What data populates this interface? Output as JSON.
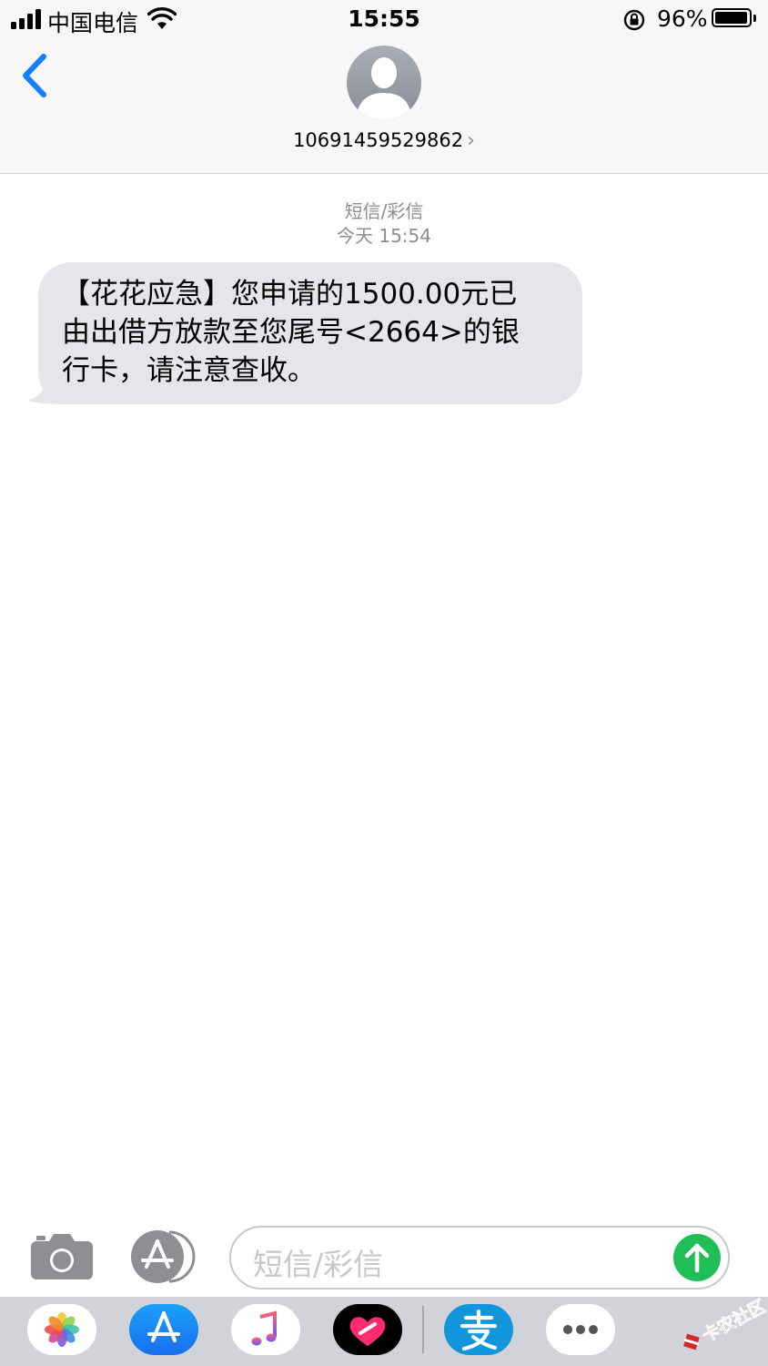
{
  "status_bar": {
    "carrier": "中国电信",
    "time": "15:55",
    "battery_percent": "96%",
    "battery_level": 0.96,
    "signal_bars": 4
  },
  "header": {
    "contact_number": "10691459529862",
    "back_icon": "chevron-left-icon",
    "avatar_icon": "person-silhouette-icon"
  },
  "conversation": {
    "service_label": "短信/彩信",
    "timestamp": "今天 15:54",
    "messages": [
      {
        "direction": "incoming",
        "lines": [
          "【花花应急】您申请的1500.00元已",
          "由出借方放款至您尾号<2664>的银",
          "行卡，请注意查收。"
        ]
      }
    ]
  },
  "composer": {
    "placeholder": "短信/彩信",
    "send_color": "#1fbf55"
  },
  "app_tray": {
    "apps": [
      "photos-icon",
      "app-store-icon",
      "music-icon",
      "digital-touch-icon",
      "alipay-icon",
      "more-icon"
    ]
  },
  "watermark": {
    "text": "卡农社区"
  },
  "colors": {
    "accent": "#147efb",
    "bubble": "#e5e5ea",
    "header_bg": "#f7f7f7",
    "tray_bg": "#d1d3d9"
  }
}
